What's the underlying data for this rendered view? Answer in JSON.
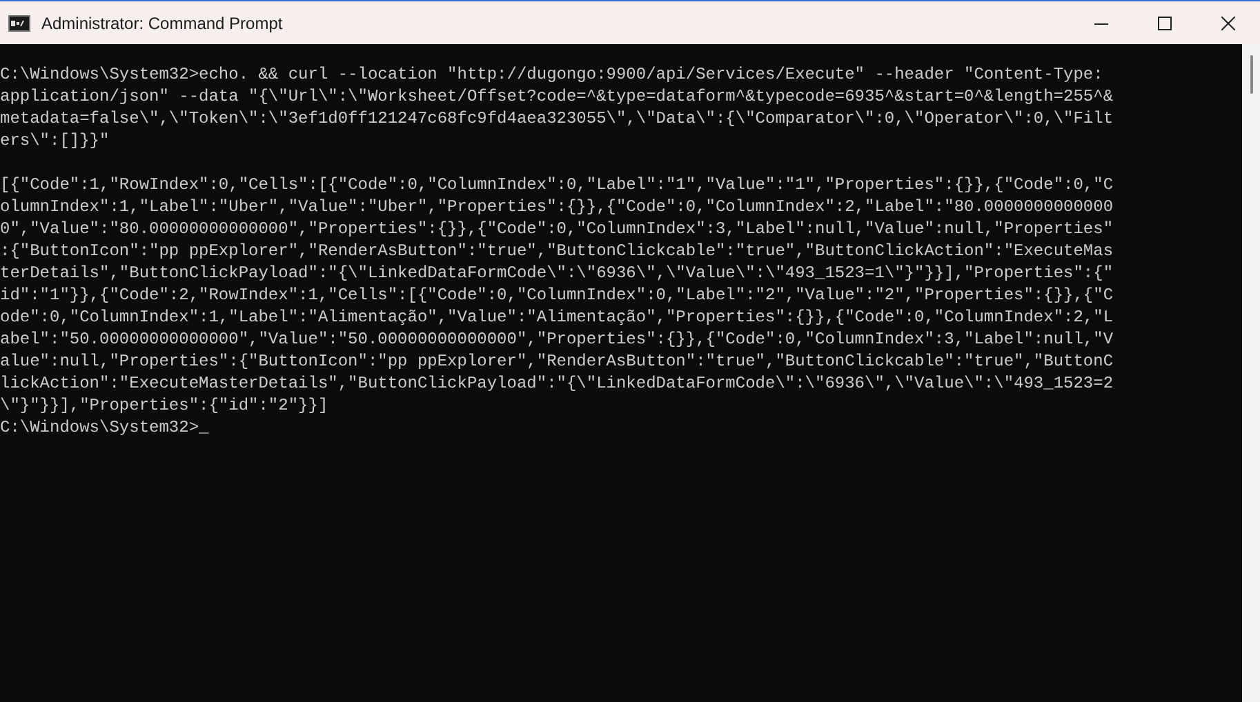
{
  "window": {
    "title": "Administrator: Command Prompt"
  },
  "console": {
    "command_lines": [
      "C:\\Windows\\System32>echo. && curl --location \"http://dugongo:9900/api/Services/Execute\" --header \"Content-Type:",
      "application/json\" --data \"{\\\"Url\\\":\\\"Worksheet/Offset?code=^&type=dataform^&typecode=6935^&start=0^&length=255^&",
      "metadata=false\\\",\\\"Token\\\":\\\"3ef1d0ff121247c68fc9fd4aea323055\\\",\\\"Data\\\":{\\\"Comparator\\\":0,\\\"Operator\\\":0,\\\"Filt",
      "ers\\\":[]}}\""
    ],
    "output_lines": [
      "[{\"Code\":1,\"RowIndex\":0,\"Cells\":[{\"Code\":0,\"ColumnIndex\":0,\"Label\":\"1\",\"Value\":\"1\",\"Properties\":{}},{\"Code\":0,\"C",
      "olumnIndex\":1,\"Label\":\"Uber\",\"Value\":\"Uber\",\"Properties\":{}},{\"Code\":0,\"ColumnIndex\":2,\"Label\":\"80.0000000000000",
      "0\",\"Value\":\"80.00000000000000\",\"Properties\":{}},{\"Code\":0,\"ColumnIndex\":3,\"Label\":null,\"Value\":null,\"Properties\"",
      ":{\"ButtonIcon\":\"pp ppExplorer\",\"RenderAsButton\":\"true\",\"ButtonClickcable\":\"true\",\"ButtonClickAction\":\"ExecuteMas",
      "terDetails\",\"ButtonClickPayload\":\"{\\\"LinkedDataFormCode\\\":\\\"6936\\\",\\\"Value\\\":\\\"493_1523=1\\\"}\"}}],\"Properties\":{\"",
      "id\":\"1\"}},{\"Code\":2,\"RowIndex\":1,\"Cells\":[{\"Code\":0,\"ColumnIndex\":0,\"Label\":\"2\",\"Value\":\"2\",\"Properties\":{}},{\"C",
      "ode\":0,\"ColumnIndex\":1,\"Label\":\"Alimentação\",\"Value\":\"Alimentação\",\"Properties\":{}},{\"Code\":0,\"ColumnIndex\":2,\"L",
      "abel\":\"50.00000000000000\",\"Value\":\"50.00000000000000\",\"Properties\":{}},{\"Code\":0,\"ColumnIndex\":3,\"Label\":null,\"V",
      "alue\":null,\"Properties\":{\"ButtonIcon\":\"pp ppExplorer\",\"RenderAsButton\":\"true\",\"ButtonClickcable\":\"true\",\"ButtonC",
      "lickAction\":\"ExecuteMasterDetails\",\"ButtonClickPayload\":\"{\\\"LinkedDataFormCode\\\":\\\"6936\\\",\\\"Value\\\":\\\"493_1523=2",
      "\\\"}\"}}],\"Properties\":{\"id\":\"2\"}}]"
    ],
    "prompt": "C:\\Windows\\System32>",
    "cursor": "_"
  }
}
